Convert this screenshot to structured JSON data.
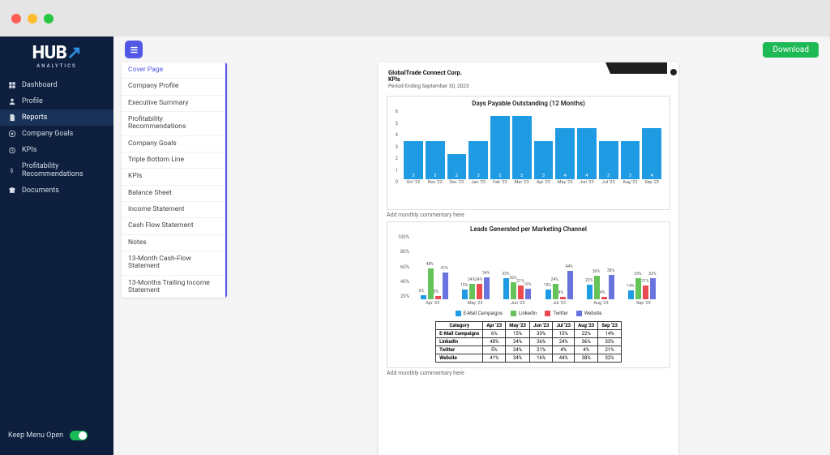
{
  "brand": {
    "line1": "HUB",
    "line2": "ANALYTICS"
  },
  "sidebar": {
    "items": [
      {
        "label": "Dashboard"
      },
      {
        "label": "Profile"
      },
      {
        "label": "Reports"
      },
      {
        "label": "Company Goals"
      },
      {
        "label": "KPIs"
      },
      {
        "label": "Profitability Recommendations"
      },
      {
        "label": "Documents"
      }
    ],
    "keep_open": "Keep Menu Open"
  },
  "topbar": {
    "download": "Download"
  },
  "outline": {
    "items": [
      "Cover Page",
      "Company Profile",
      "Executive Summary",
      "Profitability Recommendations",
      "Company Goals",
      "Triple Bottom Line",
      "KPIs",
      "Balance Sheet",
      "Income Statement",
      "Cash Flow Statement",
      "Notes",
      "13-Month Cash-Flow Statement",
      "13-Months Trailing Income Statement"
    ],
    "keep_open": "Keep Menu Open"
  },
  "report_header": {
    "company": "GlobalTrade Connect Corp.",
    "section": "KPIs",
    "period": "Period Ending September 30, 2023"
  },
  "annotations": {
    "commentary": "Add monthly commentary here"
  },
  "chart_data": [
    {
      "type": "bar",
      "title": "Days Payable Outstanding (12 Months)",
      "categories": [
        "Oct '22",
        "Nov '22",
        "Dec '22",
        "Jan '23",
        "Feb '23",
        "Mar '23",
        "Apr '23",
        "May '23",
        "Jun '23",
        "Jul '23",
        "Aug '23",
        "Sep '23"
      ],
      "values": [
        3,
        3,
        2,
        3,
        5,
        5,
        3,
        4,
        4,
        3,
        3,
        4
      ],
      "xlabel": "",
      "ylabel": "",
      "ylim": [
        0,
        6
      ],
      "yticks": [
        0,
        1,
        2,
        3,
        4,
        5,
        6
      ]
    },
    {
      "type": "bar",
      "title": "Leads Generated per Marketing Channel",
      "categories": [
        "Apr '23",
        "May '23",
        "Jun '23",
        "Jul '23",
        "Aug '23",
        "Sep '23"
      ],
      "series": [
        {
          "name": "E-Mail Campaigns",
          "color": "#1f9be3",
          "values": [
            6,
            15,
            33,
            15,
            22,
            14
          ]
        },
        {
          "name": "LinkedIn",
          "color": "#66c35a",
          "values": [
            48,
            24,
            26,
            24,
            36,
            33
          ]
        },
        {
          "name": "Twitter",
          "color": "#e94b51",
          "values": [
            5,
            24,
            21,
            4,
            4,
            21
          ]
        },
        {
          "name": "Website",
          "color": "#6a74df",
          "values": [
            41,
            34,
            16,
            44,
            38,
            32
          ]
        }
      ],
      "ylim": [
        0,
        100
      ],
      "yticks": [
        20,
        40,
        60,
        80,
        100
      ],
      "unit": "%",
      "table": {
        "header": [
          "Category",
          "Apr '23",
          "May '23",
          "Jun '23",
          "Jul '23",
          "Aug '23",
          "Sep '23"
        ],
        "rows": [
          [
            "E-Mail Campaigns",
            "6%",
            "15%",
            "33%",
            "15%",
            "22%",
            "14%"
          ],
          [
            "LinkedIn",
            "48%",
            "24%",
            "26%",
            "24%",
            "36%",
            "33%"
          ],
          [
            "Twitter",
            "5%",
            "24%",
            "21%",
            "4%",
            "4%",
            "21%"
          ],
          [
            "Website",
            "41%",
            "34%",
            "16%",
            "44%",
            "38%",
            "32%"
          ]
        ]
      }
    }
  ]
}
